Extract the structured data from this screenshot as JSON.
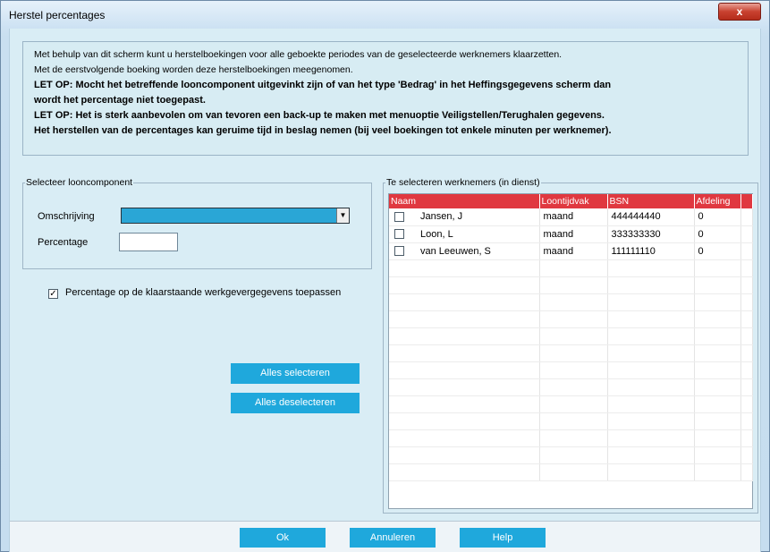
{
  "window": {
    "title": "Herstel percentages",
    "close_glyph": "x"
  },
  "info": {
    "lines": [
      "Met behulp van dit scherm kunt u herstelboekingen voor alle geboekte periodes van de geselecteerde werknemers klaarzetten.",
      "Met de eerstvolgende boeking worden deze herstelboekingen meegenomen.",
      "LET OP: Mocht het betreffende looncomponent uitgevinkt zijn of van het type 'Bedrag' in het Heffingsgegevens scherm dan",
      "wordt het percentage niet toegepast.",
      "LET OP: Het is sterk aanbevolen om van tevoren een back-up te maken met menuoptie Veiligstellen/Terughalen gegevens.",
      "Het herstellen van de percentages kan geruime tijd in beslag nemen (bij veel boekingen tot enkele minuten per werknemer)."
    ]
  },
  "looncomponent": {
    "legend": "Selecteer looncomponent",
    "omschrijving_label": "Omschrijving",
    "omschrijving_value": "",
    "percentage_label": "Percentage",
    "percentage_value": ""
  },
  "apply_checkbox": {
    "label": "Percentage op de klaarstaande werkgevergegevens toepassen",
    "checked": true,
    "mark": "✓"
  },
  "select_buttons": {
    "select_all": "Alles selecteren",
    "deselect_all": "Alles deselecteren"
  },
  "employees": {
    "legend": "Te selecteren werknemers (in dienst)",
    "columns": [
      "Naam",
      "Loontijdvak",
      "BSN",
      "Afdeling"
    ],
    "rows": [
      {
        "naam": "Jansen, J",
        "loontijdvak": "maand",
        "bsn": "444444440",
        "afdeling": "0"
      },
      {
        "naam": "Loon, L",
        "loontijdvak": "maand",
        "bsn": "333333330",
        "afdeling": "0"
      },
      {
        "naam": "van Leeuwen, S",
        "loontijdvak": "maand",
        "bsn": "111111110",
        "afdeling": "0"
      }
    ]
  },
  "footer": {
    "ok": "Ok",
    "cancel": "Annuleren",
    "help": "Help"
  },
  "colors": {
    "accent": "#1fa8dc",
    "header": "#e03840",
    "background": "#d9edf5"
  }
}
